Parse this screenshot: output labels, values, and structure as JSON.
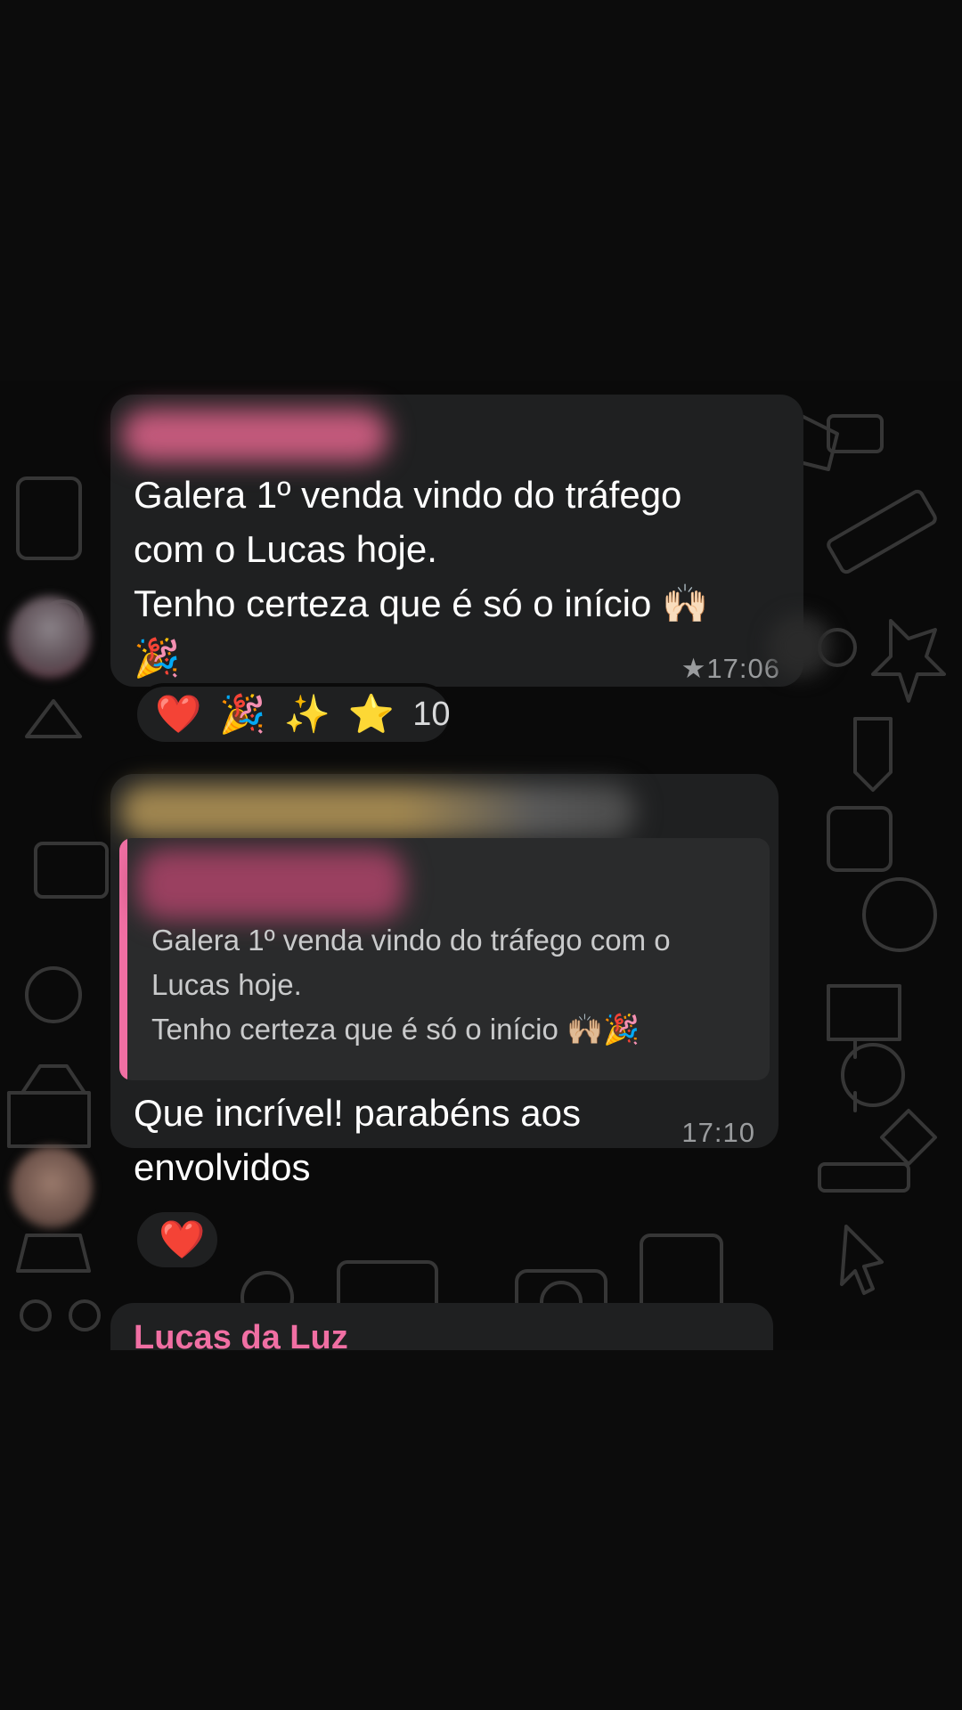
{
  "messages": [
    {
      "text": "Galera 1º venda vindo do tráfego\ncom o Lucas hoje.\nTenho certeza que é só o início 🙌🏻\n🎉",
      "time": "17:06",
      "starred": true,
      "star_icon": "★",
      "reactions": [
        "❤️",
        "🎉",
        "✨",
        "⭐"
      ],
      "reaction_count": "10"
    },
    {
      "quoted_text": "Galera 1º venda vindo do tráfego com o\nLucas hoje.\nTenho certeza que é só o início 🙌🏼🎉",
      "text": "Que incrível! parabéns aos\nenvolvidos",
      "time": "17:10",
      "reactions": [
        "❤️"
      ]
    },
    {
      "sender": "Lucas da Luz"
    }
  ],
  "colors": {
    "bubble": "#1f2021",
    "quote_background": "#2a2b2c",
    "accent_pink": "#f06fa3",
    "timestamp": "#9a9c9e"
  }
}
